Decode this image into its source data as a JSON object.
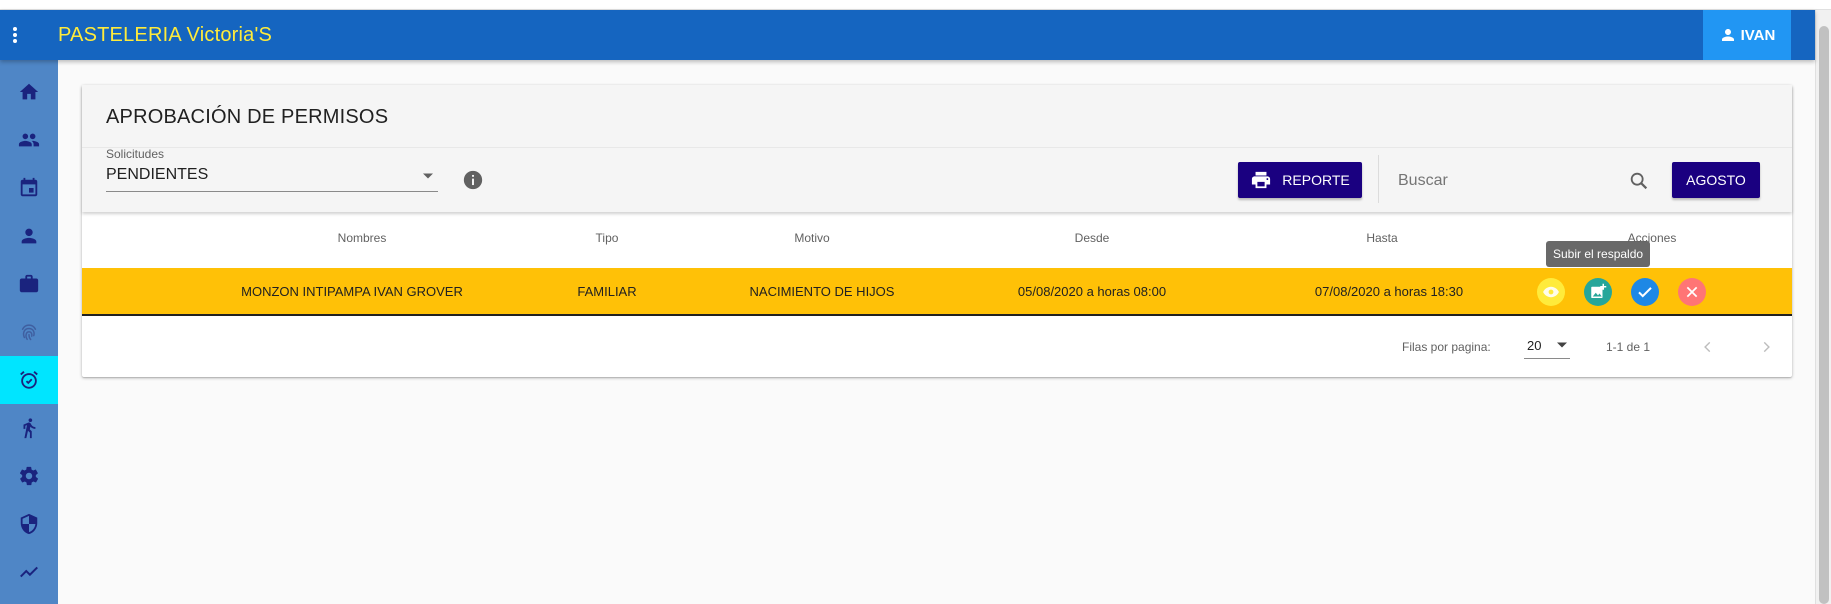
{
  "app": {
    "title": "PASTELERIA Victoria'S",
    "user_label": "IVAN",
    "colors": {
      "appbar": "#1565c0",
      "title": "#ffeb3b",
      "sidebar": "#4f86c6",
      "sidebar_active": "#00e5ff",
      "primary_button": "#1a0080",
      "row_highlight": "#ffc107"
    }
  },
  "sidebar": {
    "items": [
      {
        "icon": "home-icon",
        "active": false
      },
      {
        "icon": "people-icon",
        "active": false
      },
      {
        "icon": "calendar-icon",
        "active": false
      },
      {
        "icon": "person-icon",
        "active": false
      },
      {
        "icon": "briefcase-icon",
        "active": false
      },
      {
        "icon": "fingerprint-icon",
        "active": false
      },
      {
        "icon": "alarm-icon",
        "active": true
      },
      {
        "icon": "running-icon",
        "active": false
      },
      {
        "icon": "gear-icon",
        "active": false
      },
      {
        "icon": "shield-icon",
        "active": false
      },
      {
        "icon": "trending-icon",
        "active": false
      }
    ]
  },
  "page": {
    "title": "APROBACIÓN DE PERMISOS",
    "select": {
      "label": "Solicitudes",
      "value": "PENDIENTES"
    },
    "report_button": "REPORTE",
    "search_placeholder": "Buscar",
    "month_button": "AGOSTO"
  },
  "table": {
    "headers": [
      "Nombres",
      "Tipo",
      "Motivo",
      "Desde",
      "Hasta",
      "Acciones"
    ],
    "rows": [
      {
        "nombres": "MONZON INTIPAMPA IVAN GROVER",
        "tipo": "FAMILIAR",
        "motivo": "NACIMIENTO DE HIJOS",
        "desde": "05/08/2020 a horas 08:00",
        "hasta": "07/08/2020 a horas 18:30"
      }
    ],
    "actions": [
      {
        "icon": "eye-icon",
        "color": "#ffeb3b"
      },
      {
        "icon": "add-photo-icon",
        "color": "#26a69a"
      },
      {
        "icon": "check-icon",
        "color": "#1e88e5"
      },
      {
        "icon": "close-icon",
        "color": "#ff7575"
      }
    ],
    "tooltip": "Subir el respaldo",
    "footer": {
      "rows_per_page_label": "Filas por pagina:",
      "rows_per_page": "20",
      "range": "1-1 de 1"
    }
  }
}
